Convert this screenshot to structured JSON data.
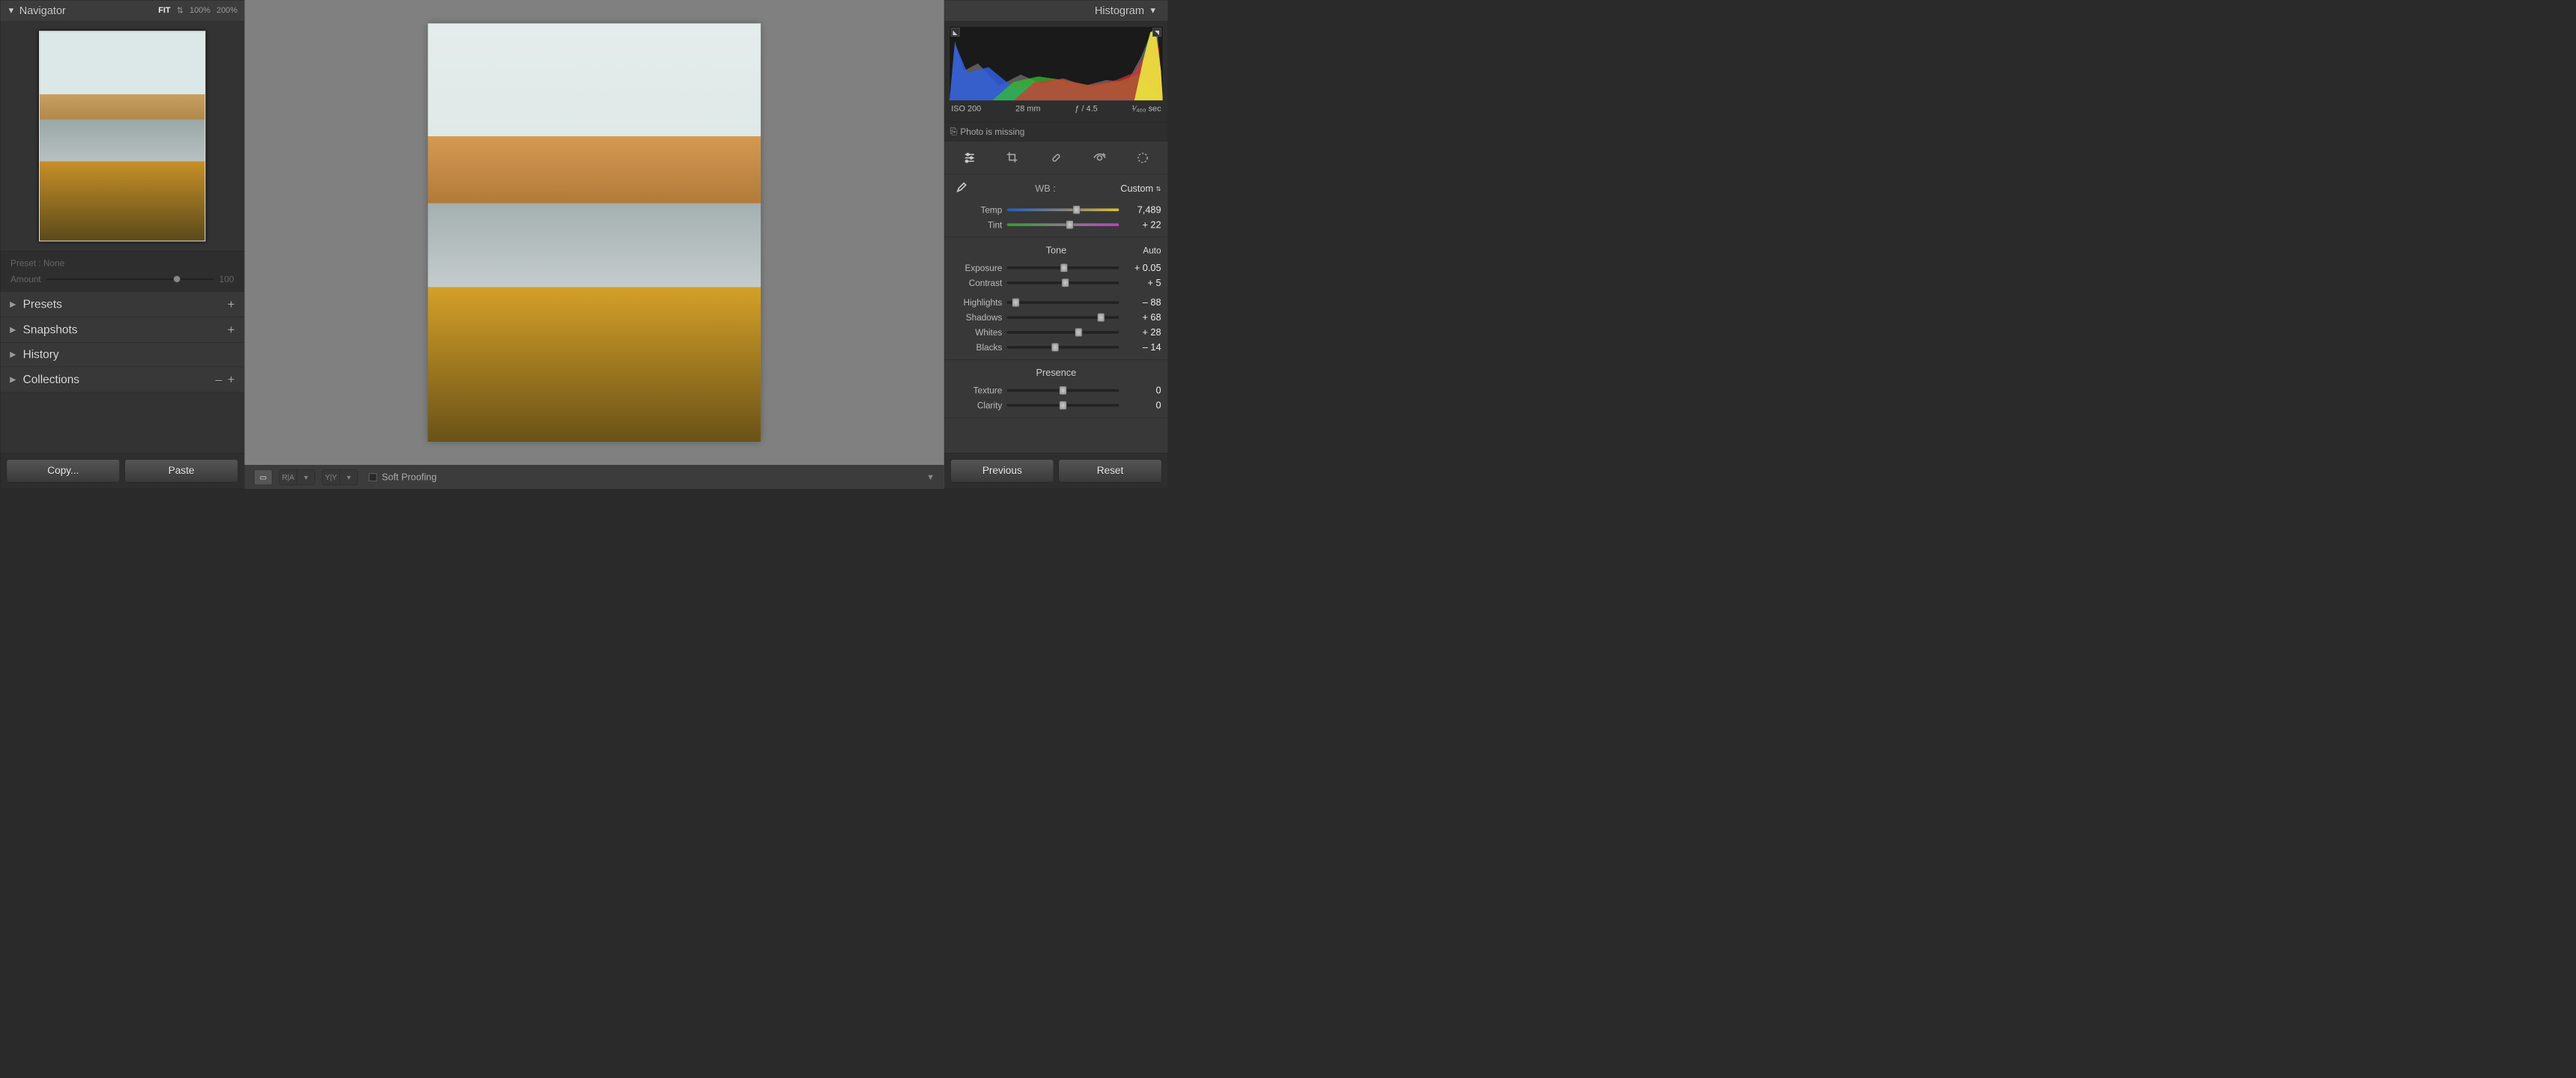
{
  "left": {
    "navigator": "Navigator",
    "zoom": {
      "fit": "FIT",
      "z100": "100%",
      "z200": "200%"
    },
    "preset_label": "Preset : None",
    "amount_label": "Amount",
    "amount_value": "100",
    "sections": {
      "presets": "Presets",
      "snapshots": "Snapshots",
      "history": "History",
      "collections": "Collections"
    },
    "copy": "Copy...",
    "paste": "Paste"
  },
  "center": {
    "soft_proofing": "Soft Proofing"
  },
  "right": {
    "histogram": "Histogram",
    "meta": {
      "iso": "ISO 200",
      "focal": "28 mm",
      "aperture": "ƒ / 4.5",
      "shutter": "¹⁄₄₀₀ sec"
    },
    "missing": "Photo is missing",
    "wb": {
      "label": "WB :",
      "mode": "Custom"
    },
    "sliders": {
      "temp": {
        "label": "Temp",
        "value": "7,489",
        "pos": 62
      },
      "tint": {
        "label": "Tint",
        "value": "+ 22",
        "pos": 56
      },
      "exposure": {
        "label": "Exposure",
        "value": "+ 0.05",
        "pos": 51
      },
      "contrast": {
        "label": "Contrast",
        "value": "+ 5",
        "pos": 52
      },
      "highlights": {
        "label": "Highlights",
        "value": "– 88",
        "pos": 8
      },
      "shadows": {
        "label": "Shadows",
        "value": "+ 68",
        "pos": 84
      },
      "whites": {
        "label": "Whites",
        "value": "+ 28",
        "pos": 64
      },
      "blacks": {
        "label": "Blacks",
        "value": "– 14",
        "pos": 43
      },
      "texture": {
        "label": "Texture",
        "value": "0",
        "pos": 50
      },
      "clarity": {
        "label": "Clarity",
        "value": "0",
        "pos": 50
      }
    },
    "tone": "Tone",
    "auto": "Auto",
    "presence": "Presence",
    "previous": "Previous",
    "reset": "Reset"
  }
}
